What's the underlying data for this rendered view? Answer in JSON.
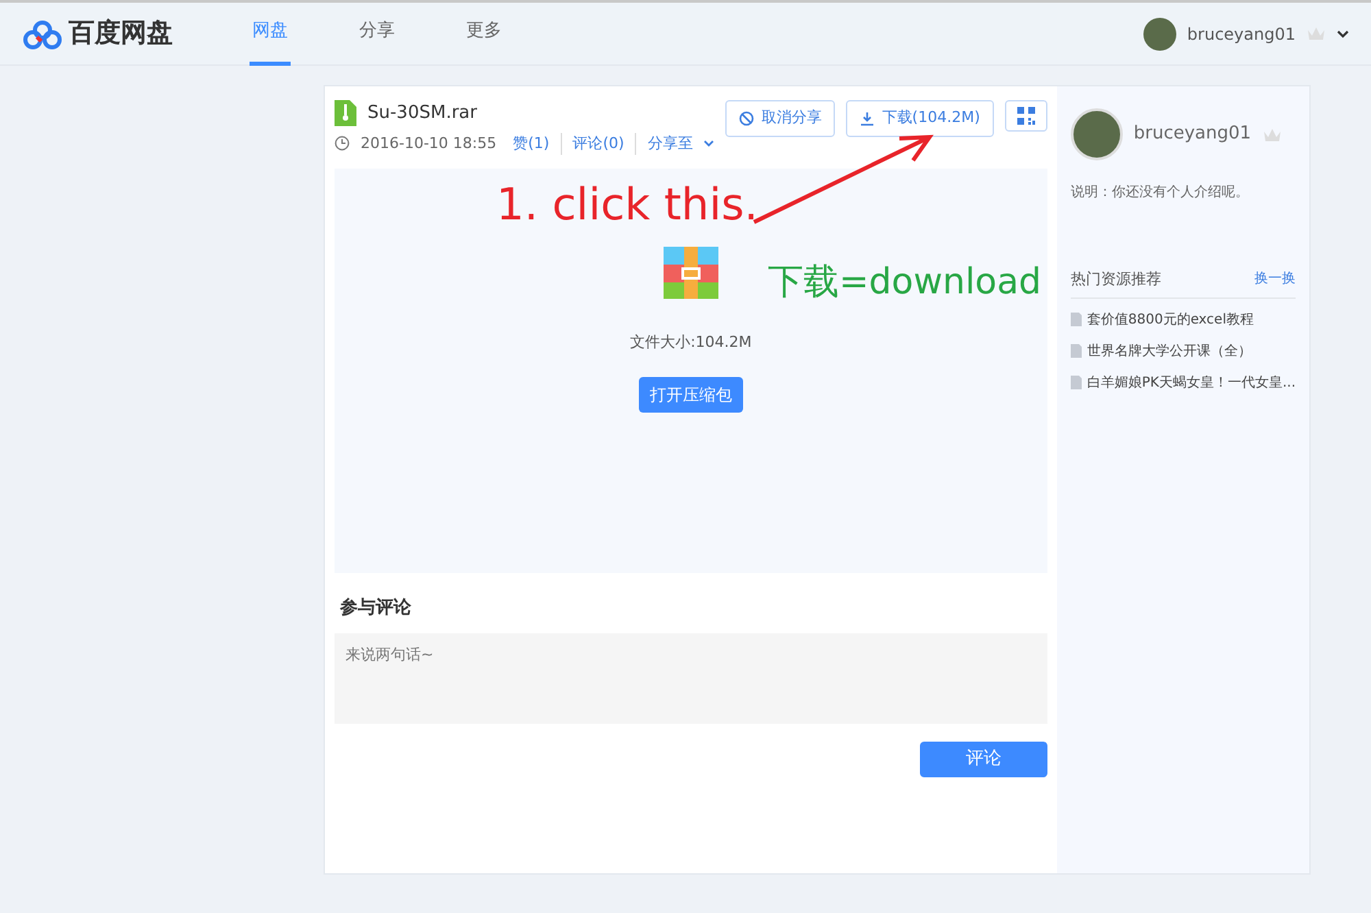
{
  "header": {
    "logo_text": "百度网盘",
    "nav": [
      {
        "label": "网盘",
        "selected": true
      },
      {
        "label": "分享",
        "selected": false
      },
      {
        "label": "更多",
        "selected": false
      }
    ],
    "username": "bruceyang01"
  },
  "file": {
    "name": "Su-30SM.rar",
    "date": "2016-10-10 18:55",
    "like": "赞(1)",
    "comments": "评论(0)",
    "share_to": "分享至",
    "buttons": {
      "cancel_share": "取消分享",
      "download": "下载(104.2M)"
    },
    "size": "文件大小:104.2M",
    "open_button": "打开压缩包"
  },
  "comment": {
    "title": "参与评论",
    "placeholder": "来说两句话~",
    "submit": "评论"
  },
  "sidebar": {
    "username": "bruceyang01",
    "bio": "说明：你还没有个人介绍呢。",
    "section_title": "热门资源推荐",
    "refresh": "换一换",
    "items": [
      "套价值8800元的excel教程",
      "世界名牌大学公开课（全）",
      "白羊媚娘PK天蝎女皇！一代女皇..."
    ]
  },
  "annotations": [
    {
      "kind": "red",
      "text": "1. click this."
    },
    {
      "kind": "green",
      "text": "下载=download"
    }
  ]
}
